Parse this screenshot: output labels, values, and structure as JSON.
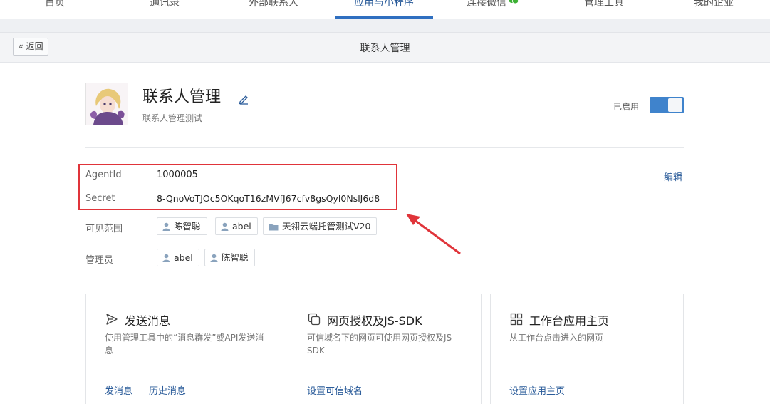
{
  "nav": {
    "items": [
      "首页",
      "通讯录",
      "外部联系人",
      "应用与小程序",
      "连接微信",
      "管理工具",
      "我的企业"
    ],
    "active_index": 3
  },
  "header": {
    "back_label": "返回",
    "title": "联系人管理"
  },
  "app": {
    "name": "联系人管理",
    "description": "联系人管理测试",
    "status_label": "已启用",
    "enabled": true
  },
  "credentials": {
    "agentid_label": "AgentId",
    "agentid_value": "1000005",
    "secret_label": "Secret",
    "secret_value": "8-QnoVoTJOc5OKqoT16zMVfJ67cfv8gsQyl0NslJ6d8",
    "edit_label": "编辑"
  },
  "visibility": {
    "label": "可见范围",
    "tags": [
      {
        "type": "user",
        "text": "陈智聪"
      },
      {
        "type": "user",
        "text": "abel"
      },
      {
        "type": "department",
        "text": "天翎云端托管测试V20"
      }
    ]
  },
  "admins": {
    "label": "管理员",
    "tags": [
      {
        "type": "user",
        "text": "abel"
      },
      {
        "type": "user",
        "text": "陈智聪"
      }
    ]
  },
  "cards": [
    {
      "icon": "send-icon",
      "title": "发送消息",
      "description": "使用管理工具中的“消息群发”或API发送消息",
      "links": [
        "发消息",
        "历史消息"
      ]
    },
    {
      "icon": "copy-icon",
      "title": "网页授权及JS-SDK",
      "description": "可信域名下的网页可使用网页授权及JS-SDK",
      "links": [
        "设置可信域名"
      ]
    },
    {
      "icon": "grid-icon",
      "title": "工作台应用主页",
      "description": "从工作台点击进入的网页",
      "links": [
        "设置应用主页"
      ]
    }
  ],
  "colors": {
    "accent": "#2f6fc0",
    "link": "#2b5c9a",
    "toggle_on": "#3f83cc",
    "highlight": "#e0343a"
  }
}
